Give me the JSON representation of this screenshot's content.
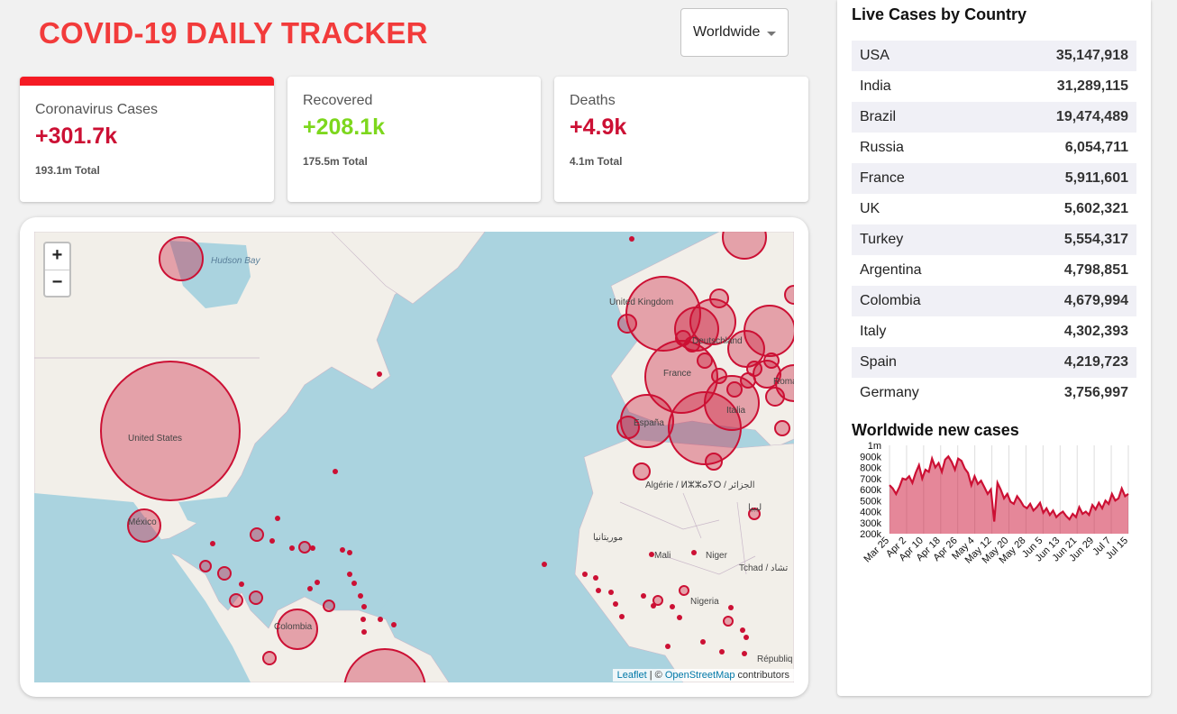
{
  "header": {
    "title": "COVID-19 DAILY TRACKER",
    "select_value": "Worldwide"
  },
  "cards": [
    {
      "title": "Coronavirus Cases",
      "value": "+301.7k",
      "total": "193.1m Total",
      "color": "#cc1034"
    },
    {
      "title": "Recovered",
      "value": "+208.1k",
      "total": "175.5m Total",
      "color": "#7dd71d"
    },
    {
      "title": "Deaths",
      "value": "+4.9k",
      "total": "4.1m Total",
      "color": "#cc1034"
    }
  ],
  "map": {
    "zoom_in": "+",
    "zoom_out": "−",
    "labels": [
      "Hudson Bay",
      "United States",
      "México",
      "United Kingdom",
      "Deutschland",
      "France",
      "España",
      "Italia",
      "Algérie / ⵍⵣⵣⴰⵢⵔ / الجزائر",
      "موريتانيا",
      "Mali",
      "Niger",
      "Tchad / تشاد",
      "Nigeria",
      "Colombia",
      "ليبيا",
      "Républiq",
      "Roma"
    ],
    "attribution_leaflet": "Leaflet",
    "attribution_sep": " | © ",
    "attribution_osm": "OpenStreetMap",
    "attribution_tail": " contributors",
    "circle_color": "#cc1034"
  },
  "sidebar": {
    "title": "Live Cases by Country",
    "countries": [
      {
        "name": "USA",
        "cases": "35,147,918"
      },
      {
        "name": "India",
        "cases": "31,289,115"
      },
      {
        "name": "Brazil",
        "cases": "19,474,489"
      },
      {
        "name": "Russia",
        "cases": "6,054,711"
      },
      {
        "name": "France",
        "cases": "5,911,601"
      },
      {
        "name": "UK",
        "cases": "5,602,321"
      },
      {
        "name": "Turkey",
        "cases": "5,554,317"
      },
      {
        "name": "Argentina",
        "cases": "4,798,851"
      },
      {
        "name": "Colombia",
        "cases": "4,679,994"
      },
      {
        "name": "Italy",
        "cases": "4,302,393"
      },
      {
        "name": "Spain",
        "cases": "4,219,723"
      },
      {
        "name": "Germany",
        "cases": "3,756,997"
      }
    ],
    "chart_title": "Worldwide new cases"
  },
  "chart_data": {
    "type": "area",
    "title": "Worldwide new cases",
    "ylim": [
      200000,
      1000000
    ],
    "y_ticks": [
      "200k",
      "300k",
      "400k",
      "500k",
      "600k",
      "700k",
      "800k",
      "900k",
      "1m"
    ],
    "x_ticks": [
      "Mar 25",
      "Apr 2",
      "Apr 10",
      "Apr 18",
      "Apr 26",
      "May 4",
      "May 12",
      "May 20",
      "May 28",
      "Jun 5",
      "Jun 13",
      "Jun 21",
      "Jun 29",
      "Jul 7",
      "Jul 15"
    ],
    "values": [
      640,
      610,
      560,
      620,
      700,
      690,
      720,
      660,
      750,
      820,
      700,
      780,
      760,
      880,
      800,
      840,
      760,
      870,
      900,
      850,
      780,
      880,
      860,
      790,
      750,
      640,
      720,
      650,
      680,
      620,
      560,
      600,
      310,
      660,
      600,
      520,
      560,
      490,
      470,
      540,
      500,
      450,
      430,
      470,
      410,
      440,
      480,
      390,
      430,
      370,
      410,
      350,
      380,
      400,
      360,
      330,
      380,
      350,
      440,
      380,
      400,
      370,
      460,
      420,
      480,
      430,
      500,
      470,
      560,
      500,
      520,
      610,
      540,
      560
    ],
    "values_unit": "thousands",
    "color": "#cc1034"
  }
}
